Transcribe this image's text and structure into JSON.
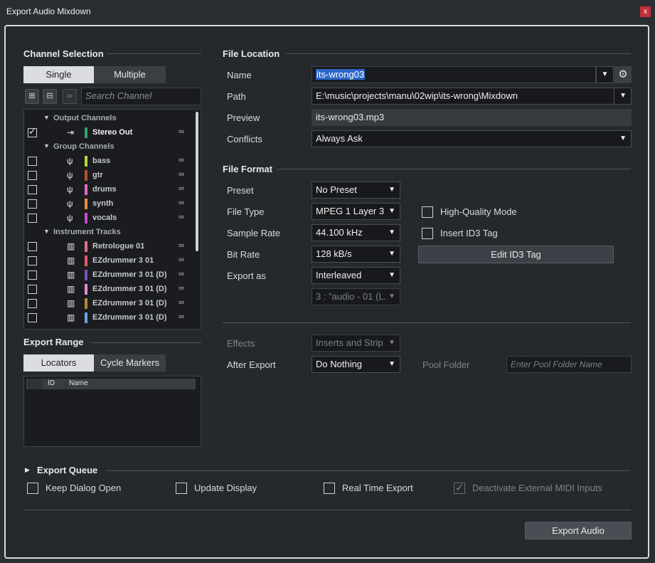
{
  "window": {
    "title": "Export Audio Mixdown",
    "close_glyph": "x"
  },
  "channel_selection": {
    "heading": "Channel Selection",
    "mode_tabs": [
      "Single",
      "Multiple"
    ],
    "search_placeholder": "Search Channel",
    "groups": [
      {
        "label": "Output Channels",
        "items": [
          {
            "name": "Stereo Out",
            "color": "#2fa36b",
            "checked": true,
            "icon": "output-icon"
          }
        ]
      },
      {
        "label": "Group Channels",
        "items": [
          {
            "name": "bass",
            "color": "#b9d63a",
            "checked": false,
            "icon": "group-channel-icon"
          },
          {
            "name": "gtr",
            "color": "#b8502d",
            "checked": false,
            "icon": "group-channel-icon"
          },
          {
            "name": "drums",
            "color": "#e06cc4",
            "checked": false,
            "icon": "group-channel-icon"
          },
          {
            "name": "synth",
            "color": "#e88f45",
            "checked": false,
            "icon": "group-channel-icon"
          },
          {
            "name": "vocals",
            "color": "#c84ad0",
            "checked": false,
            "icon": "group-channel-icon"
          }
        ]
      },
      {
        "label": "Instrument Tracks",
        "items": [
          {
            "name": "Retrologue 01",
            "color": "#e0708a",
            "checked": false,
            "icon": "instrument-icon"
          },
          {
            "name": "EZdrummer 3 01",
            "color": "#e45a6a",
            "checked": false,
            "icon": "instrument-icon"
          },
          {
            "name": "EZdrummer 3 01 (D)",
            "color": "#7a4fc0",
            "checked": false,
            "icon": "instrument-icon"
          },
          {
            "name": "EZdrummer 3 01 (D)",
            "color": "#e98ad8",
            "checked": false,
            "icon": "instrument-icon"
          },
          {
            "name": "EZdrummer 3 01 (D)",
            "color": "#b08a30",
            "checked": false,
            "icon": "instrument-icon"
          },
          {
            "name": "EZdrummer 3 01 (D)",
            "color": "#6aa2e8",
            "checked": false,
            "icon": "instrument-icon"
          }
        ]
      }
    ]
  },
  "export_range": {
    "heading": "Export Range",
    "tabs": [
      "Locators",
      "Cycle Markers"
    ],
    "columns": [
      "ID",
      "Name"
    ]
  },
  "file_location": {
    "heading": "File Location",
    "name_label": "Name",
    "name_value": "its-wrong03",
    "path_label": "Path",
    "path_value": "E:\\music\\projects\\manu\\02wip\\its-wrong\\Mixdown",
    "preview_label": "Preview",
    "preview_value": "its-wrong03.mp3",
    "conflicts_label": "Conflicts",
    "conflicts_value": "Always Ask"
  },
  "file_format": {
    "heading": "File Format",
    "preset_label": "Preset",
    "preset_value": "No Preset",
    "file_type_label": "File Type",
    "file_type_value": "MPEG 1 Layer 3",
    "sample_rate_label": "Sample Rate",
    "sample_rate_value": "44.100 kHz",
    "bit_rate_label": "Bit Rate",
    "bit_rate_value": "128 kB/s",
    "export_as_label": "Export as",
    "export_as_value": "Interleaved",
    "channel_value": "3 : \"audio - 01 (L.",
    "high_quality_label": "High-Quality Mode",
    "insert_id3_label": "Insert ID3 Tag",
    "edit_id3_label": "Edit ID3 Tag"
  },
  "post": {
    "effects_label": "Effects",
    "effects_value": "Inserts and Strip",
    "after_export_label": "After Export",
    "after_export_value": "Do Nothing",
    "pool_folder_label": "Pool Folder",
    "pool_folder_placeholder": "Enter Pool Folder Name"
  },
  "export_queue": {
    "heading": "Export Queue",
    "keep_open": "Keep Dialog Open",
    "update_display": "Update Display",
    "real_time": "Real Time Export",
    "deactivate_midi": "Deactivate External MIDI Inputs"
  },
  "export_button": "Export Audio",
  "colors": {
    "accent_selection": "#2b66c9",
    "background": "#25282c"
  }
}
